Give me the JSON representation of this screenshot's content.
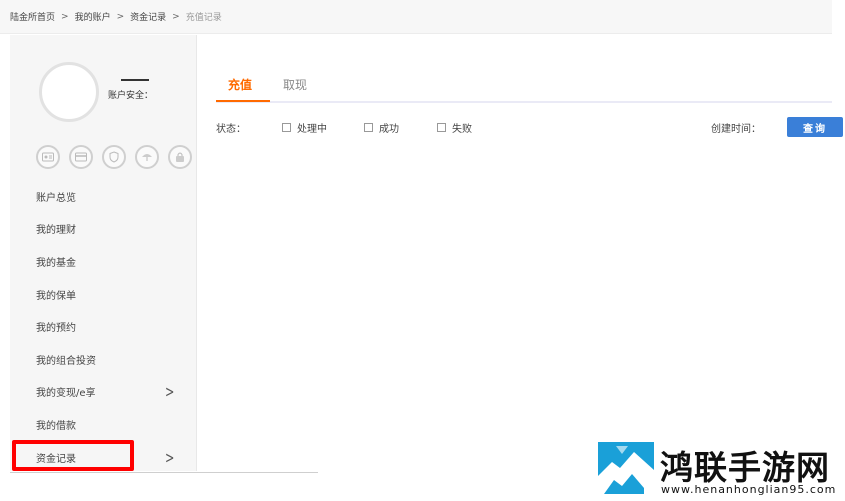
{
  "breadcrumb": {
    "home": "陆金所首页",
    "account": "我的账户",
    "funds": "资金记录",
    "current": "充值记录",
    "separator": ">"
  },
  "sidebar": {
    "security_label": "账户安全：",
    "icons": [
      "id-card-icon",
      "bank-card-icon",
      "shield-icon",
      "umbrella-icon",
      "lock-icon"
    ],
    "items": [
      {
        "label": "账户总览",
        "chevron": false
      },
      {
        "label": "我的理财",
        "chevron": false
      },
      {
        "label": "我的基金",
        "chevron": false
      },
      {
        "label": "我的保单",
        "chevron": false
      },
      {
        "label": "我的预约",
        "chevron": false
      },
      {
        "label": "我的组合投资",
        "chevron": false
      },
      {
        "label": "我的变现/e享",
        "chevron": true
      },
      {
        "label": "我的借款",
        "chevron": false
      },
      {
        "label": "资金记录",
        "chevron": true
      }
    ],
    "chevron_glyph": ">"
  },
  "main": {
    "tabs": [
      {
        "label": "充值",
        "active": true
      },
      {
        "label": "取现",
        "active": false
      }
    ],
    "filter": {
      "status_label": "状态：",
      "options": [
        "处理中",
        "成功",
        "失败"
      ],
      "created_label": "创建时间：",
      "query_button": "查询"
    }
  },
  "watermark": {
    "title": "鸿联手游网",
    "url": "www.henanhonglian95.com"
  },
  "colors": {
    "accent": "#ff6a00",
    "button": "#3a7fd8",
    "highlight": "#ff0000",
    "logo": "#1aa0d8"
  }
}
